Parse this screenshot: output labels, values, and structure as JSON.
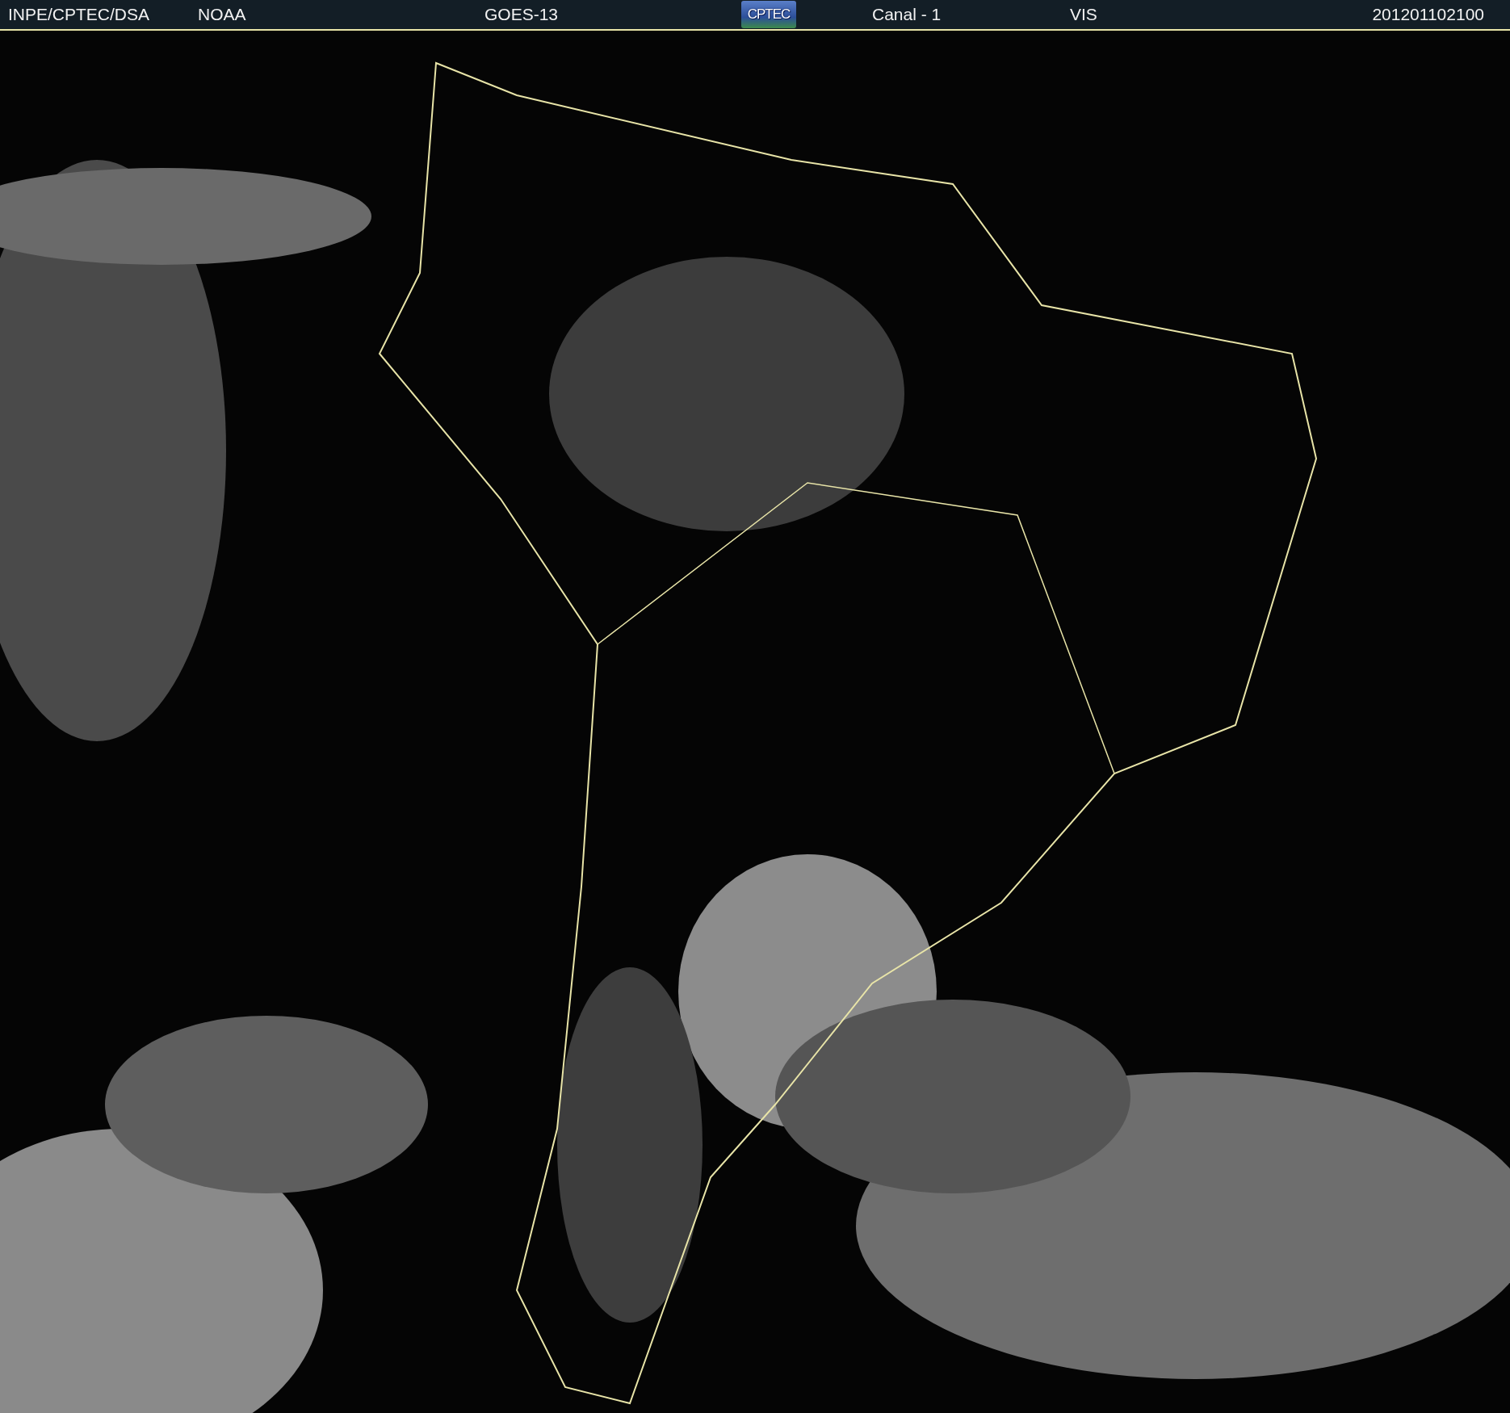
{
  "header": {
    "items": [
      "INPE/CPTEC/DSA",
      "NOAA",
      "GOES-13"
    ],
    "logo": {
      "text": "CPTEC"
    },
    "items_after_logo": [
      "Canal - 1",
      "VIS"
    ],
    "timestamp": "201201102100"
  }
}
